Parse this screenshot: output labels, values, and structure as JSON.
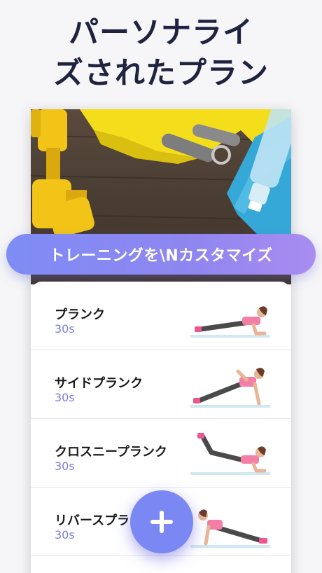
{
  "headline": {
    "line1": "パーソナライ",
    "line2": "ズされたプラン"
  },
  "banner": {
    "label": "トレーニングを\\Nカスタマイズ"
  },
  "exercises": [
    {
      "name": "プランク",
      "duration": "30s"
    },
    {
      "name": "サイドプランク",
      "duration": "30s"
    },
    {
      "name": "クロスニープランク",
      "duration": "30s"
    },
    {
      "name": "リバースプランク",
      "duration": "30s"
    }
  ],
  "icons": {
    "add": "plus-icon"
  },
  "colors": {
    "accent": "#7b87f2",
    "duration_text": "#7a7fd8",
    "headline_text": "#1f2340"
  }
}
